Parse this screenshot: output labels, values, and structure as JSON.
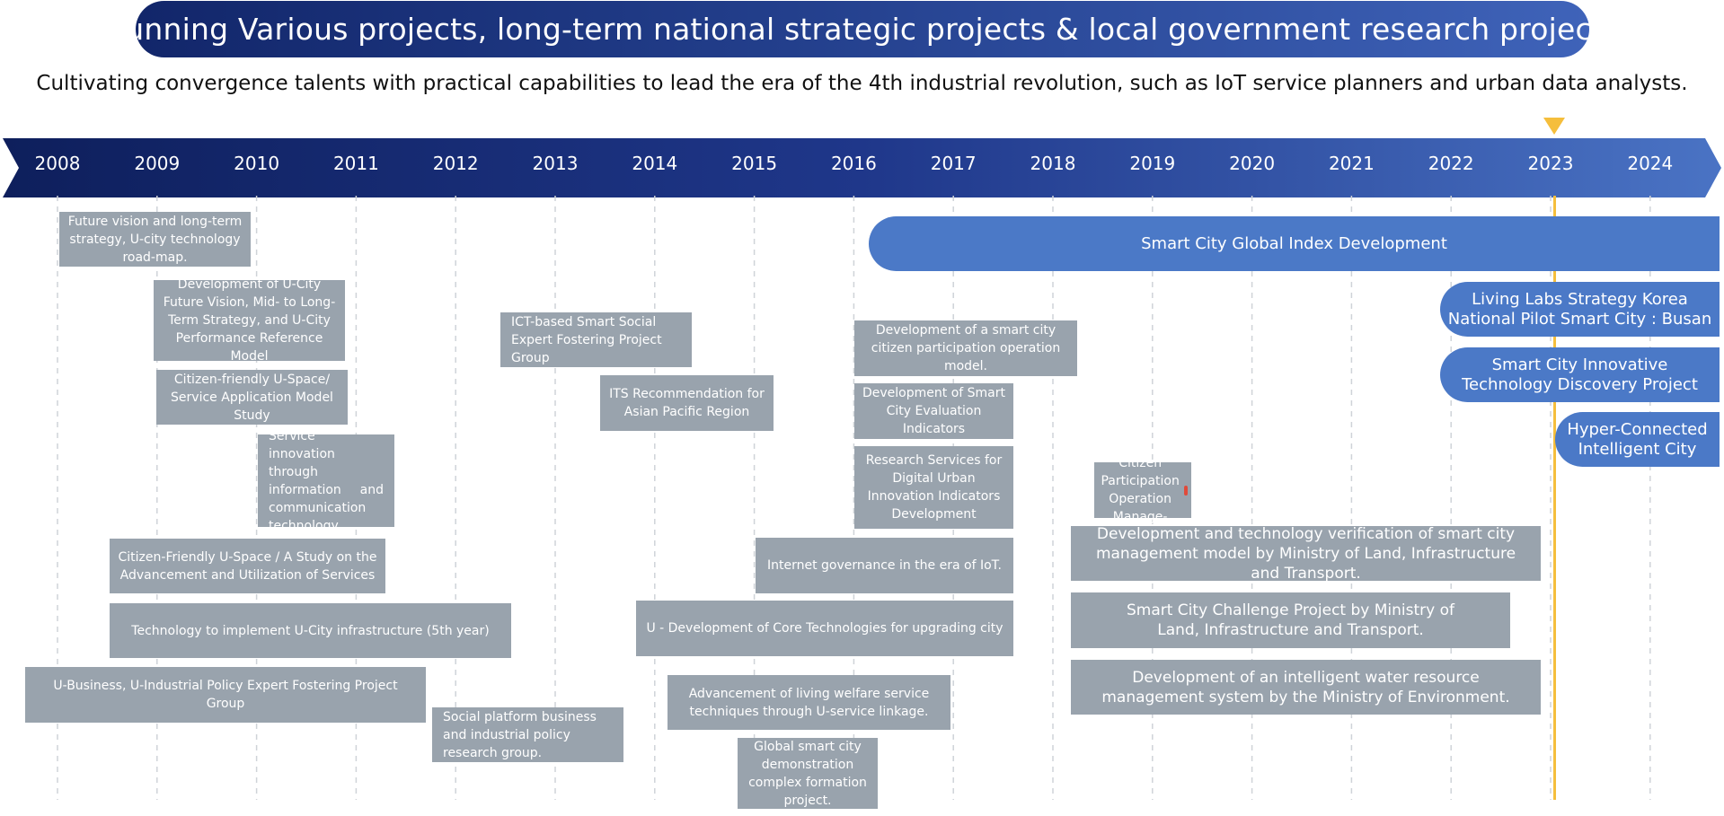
{
  "header": {
    "title": "Running Various projects, long-term national strategic projects & local government research projects",
    "subtitle": "Cultivating convergence talents with practical capabilities to lead the era of the 4th industrial revolution, such as IoT service planners and urban data analysts."
  },
  "timeline": {
    "years": [
      "2008",
      "2009",
      "2010",
      "2011",
      "2012",
      "2013",
      "2014",
      "2015",
      "2016",
      "2017",
      "2018",
      "2019",
      "2020",
      "2021",
      "2022",
      "2023",
      "2024"
    ],
    "current_year": "2023",
    "colors": {
      "arrow_start": "#0e1f5c",
      "arrow_end": "#4a73c4",
      "marker": "#f5be3c",
      "gray_box": "#99a3ad",
      "blue_box": "#4b79c7"
    }
  },
  "gray_projects": [
    "Future vision and long-term strategy, U-city technology road-map.",
    "Development of U-City Future Vision, Mid- to Long-Term Strategy, and U-City Performance Reference Model",
    "Citizen-friendly U-Space/ Service Application Model Study",
    "Service innovation through information and communication technology.",
    "Citizen-Friendly U-Space / A Study on the Advancement and Utilization of Services",
    "Technology to implement U-City infrastructure (5th year)",
    "U-Business, U-Industrial Policy Expert Fostering Project Group",
    "Social platform business and industrial policy research group.",
    "ICT-based Smart Social Expert Fostering Project Group",
    "ITS Recommendation for Asian Pacific Region",
    "U - Development of Core Technologies for upgrading city",
    "Advancement of living welfare service techniques through U-service linkage.",
    "Global smart city demonstration complex formation project.",
    "Internet governance in the era of IoT.",
    "Development of a smart city citizen participation operation model.",
    "Development of Smart City Evaluation Indicators",
    "Research Services for Digital Urban Innovation Indicators Development",
    "Citizen Participation Operation Manage-",
    "Development and technology verification of smart city management model by Ministry of Land, Infrastructure and Transport.",
    "Smart City Challenge Project by Ministry of Land, Infrastructure and Transport.",
    "Development of an intelligent water resource management system by the Ministry of Environment."
  ],
  "blue_projects": [
    "Smart City Global Index Development",
    "Living Labs Strategy  Korea National Pilot Smart City : Busan",
    "Smart City Innovative Technology Discovery Project",
    "Hyper-Connected Intelligent City"
  ]
}
